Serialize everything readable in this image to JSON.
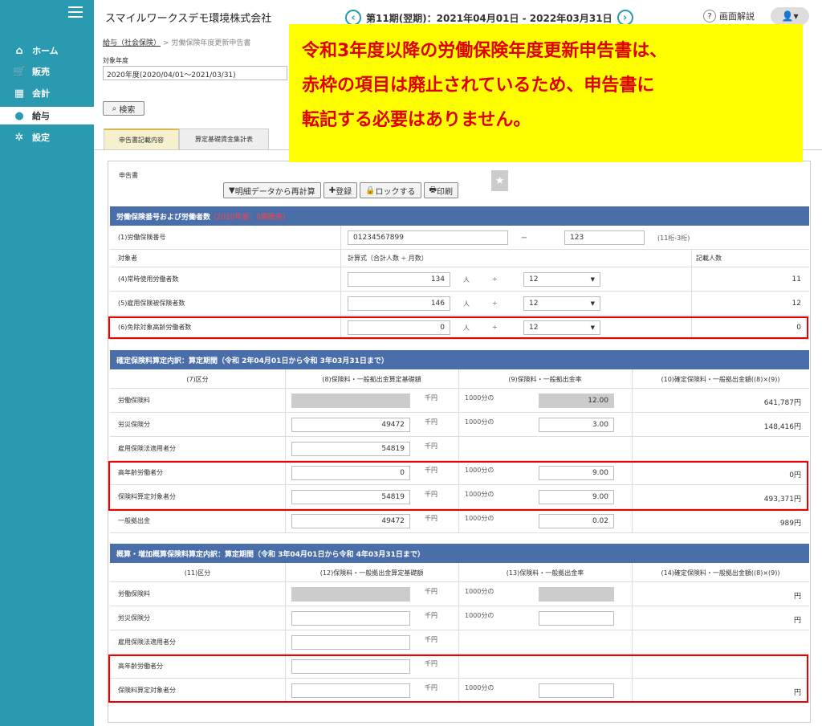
{
  "sidebar": {
    "items": [
      {
        "icon": "home-icon",
        "label": "ホーム"
      },
      {
        "icon": "cart-icon",
        "label": "販売"
      },
      {
        "icon": "calculator-icon",
        "label": "会計"
      },
      {
        "icon": "moneybag-icon",
        "label": "給与"
      },
      {
        "icon": "gear-icon",
        "label": "設定"
      }
    ]
  },
  "header": {
    "company": "スマイルワークスデモ環境株式会社",
    "period": "第11期(翌期)：2021年04月01日 - 2022年03月31日",
    "help": "画面解説"
  },
  "breadcrumb": {
    "parent": "給与（社会保険）",
    "sep": ">",
    "current": "労働保険年度更新申告書"
  },
  "filter": {
    "label": "対象年度",
    "value": "2020年度(2020/04/01～2021/03/31)",
    "search": "検索"
  },
  "tabs": [
    "申告書記載内容",
    "算定基礎賃金集計表"
  ],
  "form": {
    "label": "申告書",
    "buttons": {
      "recalc": "明細データから再計算",
      "save": "登録",
      "lock": "ロックする",
      "print": "印刷"
    }
  },
  "callout": {
    "line1": "令和3年度以降の労働保険年度更新申告書は、",
    "line2": "赤枠の項目は廃止されているため、申告書に",
    "line3": "転記する必要はありません。"
  },
  "section1": {
    "title": "労働保険番号および労働者数",
    "note": "(2020年度：0期販売)",
    "insno_label": "(1)労働保険番号",
    "insno_1": "01234567899",
    "dash": "ー",
    "insno_2": "123",
    "digits": "(11桁-3桁)",
    "col_target": "対象者",
    "col_formula": "計算式（合計人数 ÷ 月数）",
    "col_count": "記載人数",
    "rows": [
      {
        "label": "(4)常時使用労働者数",
        "total": "134",
        "unit": "人",
        "div": "÷",
        "months": "12",
        "result": "11"
      },
      {
        "label": "(5)雇用保険被保険者数",
        "total": "146",
        "unit": "人",
        "div": "÷",
        "months": "12",
        "result": "12"
      },
      {
        "label": "(6)免除対象高齢労働者数",
        "total": "0",
        "unit": "人",
        "div": "÷",
        "months": "12",
        "result": "0"
      }
    ]
  },
  "section2": {
    "title": "確定保険料算定内訳：算定期間（令和 2年04月01日から令和 3年03月31日まで）",
    "h1": "(7)区分",
    "h2": "(8)保険料・一般拠出金算定基礎額",
    "h3": "(9)保険料・一般拠出金率",
    "h4": "(10)確定保険料・一般拠出金額((8)×(9))",
    "rows": [
      {
        "label": "労働保険料",
        "base": "",
        "rate": "12.00",
        "amount": "641,787円"
      },
      {
        "label": "労災保険分",
        "base": "49472",
        "rate": "3.00",
        "amount": "148,416円"
      },
      {
        "label": "雇用保険法適用者分",
        "base": "54819",
        "rate": "",
        "amount": ""
      },
      {
        "label": "高年齢労働者分",
        "base": "0",
        "rate": "9.00",
        "amount": "0円"
      },
      {
        "label": "保険料算定対象者分",
        "base": "54819",
        "rate": "9.00",
        "amount": "493,371円"
      },
      {
        "label": "一般拠出金",
        "base": "49472",
        "rate": "0.02",
        "amount": "989円"
      }
    ],
    "unit_yen": "千円",
    "per_mille": "1000分の"
  },
  "section3": {
    "title": "概算・増加概算保険料算定内訳：算定期間（令和 3年04月01日から令和 4年03月31日まで）",
    "h1": "(11)区分",
    "h2": "(12)保険料・一般拠出金算定基礎額",
    "h3": "(13)保険料・一般拠出金率",
    "h4": "(14)確定保険料・一般拠出金額((8)×(9))",
    "rows": [
      {
        "label": "労働保険料",
        "amount": "円"
      },
      {
        "label": "労災保険分",
        "amount": "円"
      },
      {
        "label": "雇用保険法適用者分",
        "amount": ""
      },
      {
        "label": "高年齢労働者分",
        "amount": ""
      },
      {
        "label": "保険料算定対象者分",
        "amount": "円"
      }
    ]
  }
}
